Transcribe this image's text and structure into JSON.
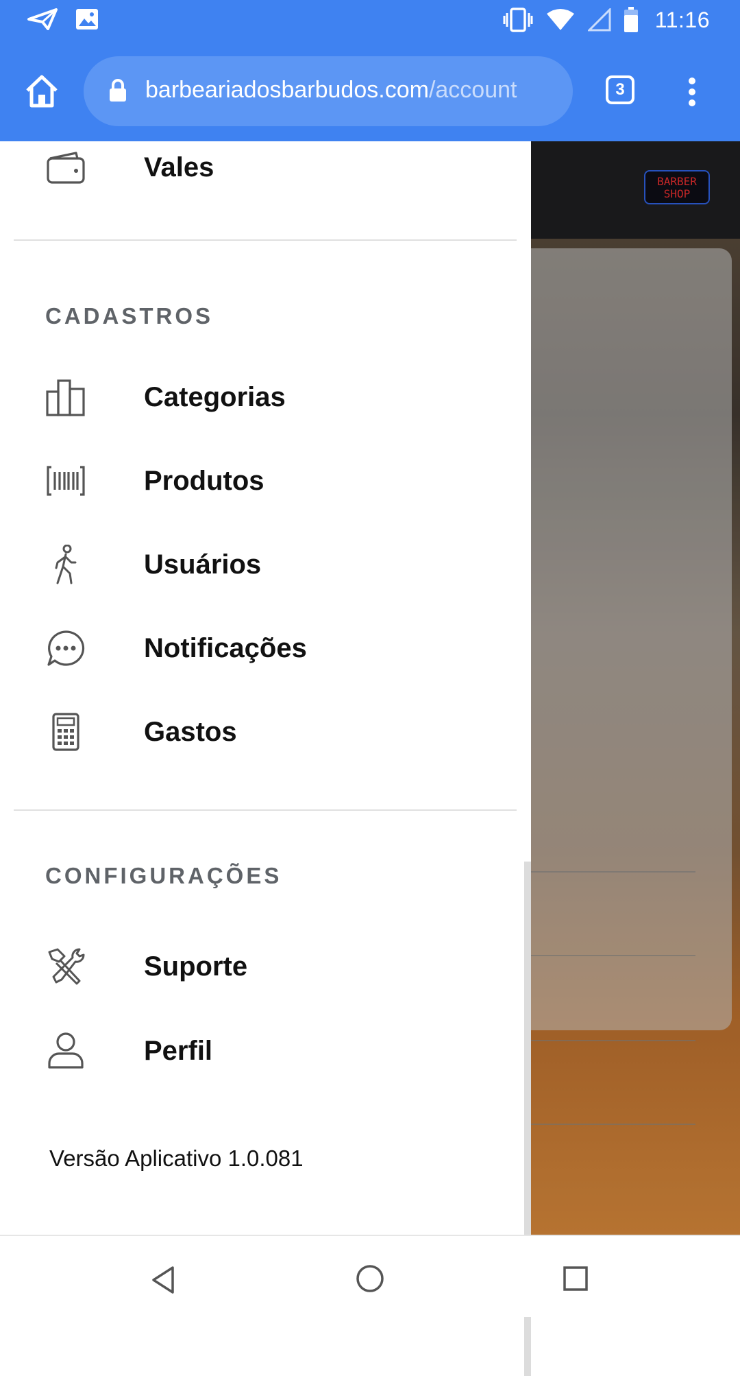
{
  "status_bar": {
    "time": "11:16",
    "icons": [
      "send-notification-icon",
      "gallery-notification-icon",
      "vibrate-icon",
      "wifi-icon",
      "signal-icon",
      "battery-icon"
    ]
  },
  "browser": {
    "url_domain": "barbeariadosbarbudos.com",
    "url_path": "/account",
    "tab_count": "3",
    "accent_color": "#3f82f1"
  },
  "background_page": {
    "logo_line1": "BARBER",
    "logo_line2": "SHOP"
  },
  "drawer": {
    "top_item": {
      "label": "Vales",
      "icon": "wallet-icon"
    },
    "sections": [
      {
        "title": "CADASTROS",
        "items": [
          {
            "label": "Categorias",
            "icon": "bar-chart-icon"
          },
          {
            "label": "Produtos",
            "icon": "barcode-icon"
          },
          {
            "label": "Usuários",
            "icon": "walking-person-icon"
          },
          {
            "label": "Notificações",
            "icon": "chat-bubble-icon"
          },
          {
            "label": "Gastos",
            "icon": "calculator-icon"
          }
        ]
      },
      {
        "title": "CONFIGURAÇÕES",
        "items": [
          {
            "label": "Suporte",
            "icon": "tools-icon"
          },
          {
            "label": "Perfil",
            "icon": "user-icon"
          }
        ]
      }
    ],
    "version": "Versão Aplicativo 1.0.081"
  },
  "nav_bar": {
    "buttons": [
      "back-icon",
      "home-circle-icon",
      "recents-icon"
    ]
  }
}
